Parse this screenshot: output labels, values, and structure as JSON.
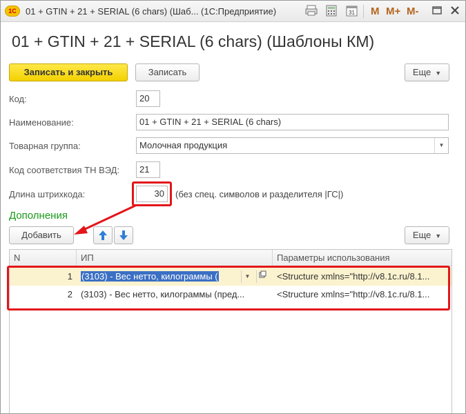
{
  "window": {
    "title": "01 + GTIN + 21 + SERIAL (6 chars) (Шаб...  (1С:Предприятие)",
    "logo_text": "1С",
    "m_labels": [
      "M",
      "M+",
      "M-"
    ]
  },
  "page": {
    "title": "01 + GTIN + 21 + SERIAL (6 chars) (Шаблоны КМ)"
  },
  "toolbar": {
    "save_close_label": "Записать и закрыть",
    "save_label": "Записать",
    "more_label": "Еще"
  },
  "form": {
    "code_label": "Код:",
    "code_value": "20",
    "name_label": "Наименование:",
    "name_value": "01 + GTIN + 21 + SERIAL (6 chars)",
    "group_label": "Товарная группа:",
    "group_value": "Молочная продукция",
    "tnved_label": "Код соответствия ТН ВЭД:",
    "tnved_value": "21",
    "barcode_len_label": "Длина штрихкода:",
    "barcode_len_value": "30",
    "barcode_len_hint": "(без спец. символов и разделителя |ГС|)"
  },
  "additions": {
    "title": "Дополнения",
    "add_label": "Добавить",
    "more_label": "Еще",
    "columns": [
      "N",
      "ИП",
      "Параметры использования"
    ],
    "rows": [
      {
        "n": "1",
        "ip": "(3103) - Вес нетто, килограммы (",
        "params": "<Structure xmlns=\"http://v8.1c.ru/8.1..."
      },
      {
        "n": "2",
        "ip": "(3103) - Вес нетто, килограммы (пред...",
        "params": "<Structure xmlns=\"http://v8.1c.ru/8.1..."
      }
    ]
  },
  "colors": {
    "primary_button": "#f3d100",
    "section_title": "#1a9a1a",
    "annotation": "#e3151a",
    "selection": "#3b6fc4"
  }
}
